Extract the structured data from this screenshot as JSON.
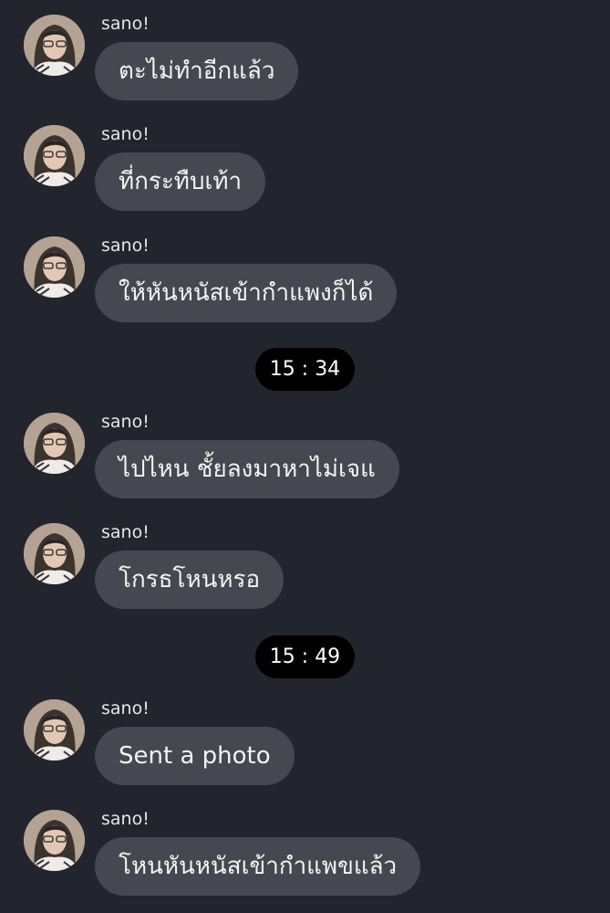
{
  "conversation": {
    "messages": [
      {
        "sender": "sano!",
        "text": "ตะไม่ทำอีกแล้ว"
      },
      {
        "sender": "sano!",
        "text": "ที่กระทืบเท้า"
      },
      {
        "sender": "sano!",
        "text": "ให้หันหนัสเข้ากำแพงก็ได้"
      },
      {
        "sender": "sano!",
        "text": "ไปไหน ชั้ยลงมาหาไม่เจแ"
      },
      {
        "sender": "sano!",
        "text": "โกรธโหนหรอ"
      },
      {
        "sender": "sano!",
        "text": "Sent a photo"
      },
      {
        "sender": "sano!",
        "text": "โหนหันหนัสเข้ากำแพขแล้ว"
      }
    ],
    "timestamps": [
      "15 : 34",
      "15 : 49"
    ]
  },
  "avatar_icon": "profile-photo-icon",
  "colors": {
    "background": "#22252e",
    "bubble": "#454851",
    "time_pill": "#000000",
    "text": "#f4f4f4"
  }
}
